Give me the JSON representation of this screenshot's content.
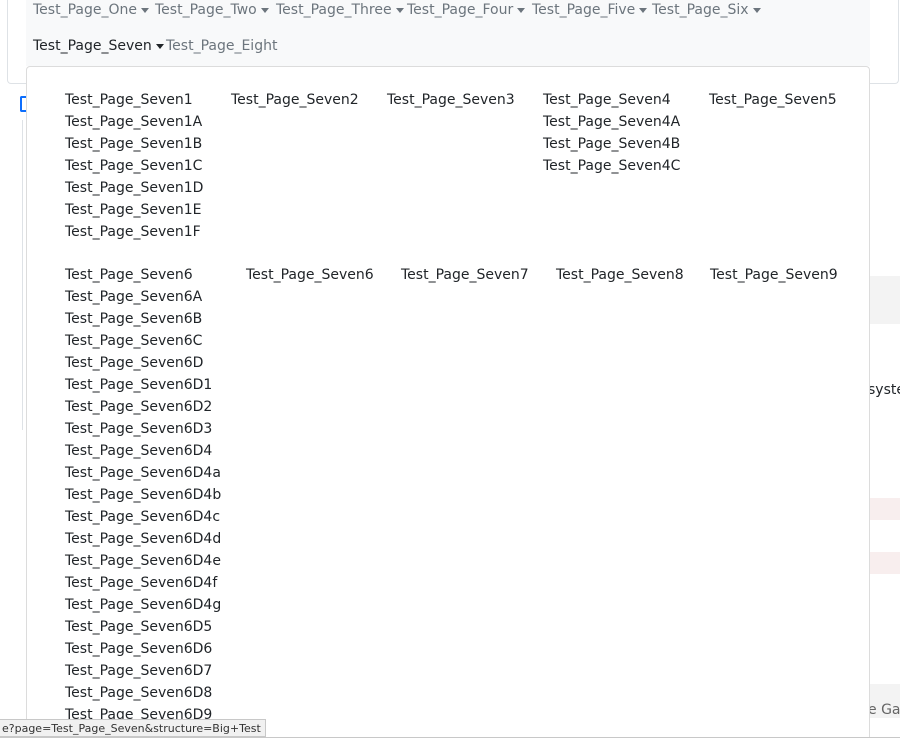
{
  "nav": {
    "row1": [
      {
        "label": "Test_Page_One",
        "caret": true
      },
      {
        "label": "Test_Page_Two",
        "caret": true
      },
      {
        "label": "Test_Page_Three",
        "caret": true
      },
      {
        "label": "Test_Page_Four",
        "caret": true
      },
      {
        "label": "Test_Page_Five",
        "caret": true
      },
      {
        "label": "Test_Page_Six",
        "caret": true
      }
    ],
    "row2": [
      {
        "label": "Test_Page_Seven",
        "caret": true,
        "active": true
      },
      {
        "label": "Test_Page_Eight",
        "caret": false
      }
    ]
  },
  "dropdown": {
    "group1": [
      {
        "items": [
          "Test_Page_Seven1",
          "Test_Page_Seven1A",
          "Test_Page_Seven1B",
          "Test_Page_Seven1C",
          "Test_Page_Seven1D",
          "Test_Page_Seven1E",
          "Test_Page_Seven1F"
        ]
      },
      {
        "items": [
          "Test_Page_Seven2"
        ]
      },
      {
        "items": [
          "Test_Page_Seven3"
        ]
      },
      {
        "items": [
          "Test_Page_Seven4",
          "Test_Page_Seven4A",
          "Test_Page_Seven4B",
          "Test_Page_Seven4C"
        ]
      },
      {
        "items": [
          "Test_Page_Seven5"
        ]
      }
    ],
    "group2": [
      {
        "items": [
          "Test_Page_Seven6",
          "Test_Page_Seven6A",
          "Test_Page_Seven6B",
          "Test_Page_Seven6C",
          "Test_Page_Seven6D",
          "Test_Page_Seven6D1",
          "Test_Page_Seven6D2",
          "Test_Page_Seven6D3",
          "Test_Page_Seven6D4",
          "Test_Page_Seven6D4a",
          "Test_Page_Seven6D4b",
          "Test_Page_Seven6D4c",
          "Test_Page_Seven6D4d",
          "Test_Page_Seven6D4e",
          "Test_Page_Seven6D4f",
          "Test_Page_Seven6D4g",
          "Test_Page_Seven6D5",
          "Test_Page_Seven6D6",
          "Test_Page_Seven6D7",
          "Test_Page_Seven6D8",
          "Test_Page_Seven6D9"
        ]
      },
      {
        "items": [
          "Test_Page_Seven6"
        ]
      },
      {
        "items": [
          "Test_Page_Seven7"
        ]
      },
      {
        "items": [
          "Test_Page_Seven8"
        ]
      },
      {
        "items": [
          "Test_Page_Seven9"
        ]
      }
    ]
  },
  "background": {
    "text_fragment_1": "syste",
    "text_fragment_2": "e Gal"
  },
  "status_url": "e?page=Test_Page_Seven&structure=Big+Test"
}
